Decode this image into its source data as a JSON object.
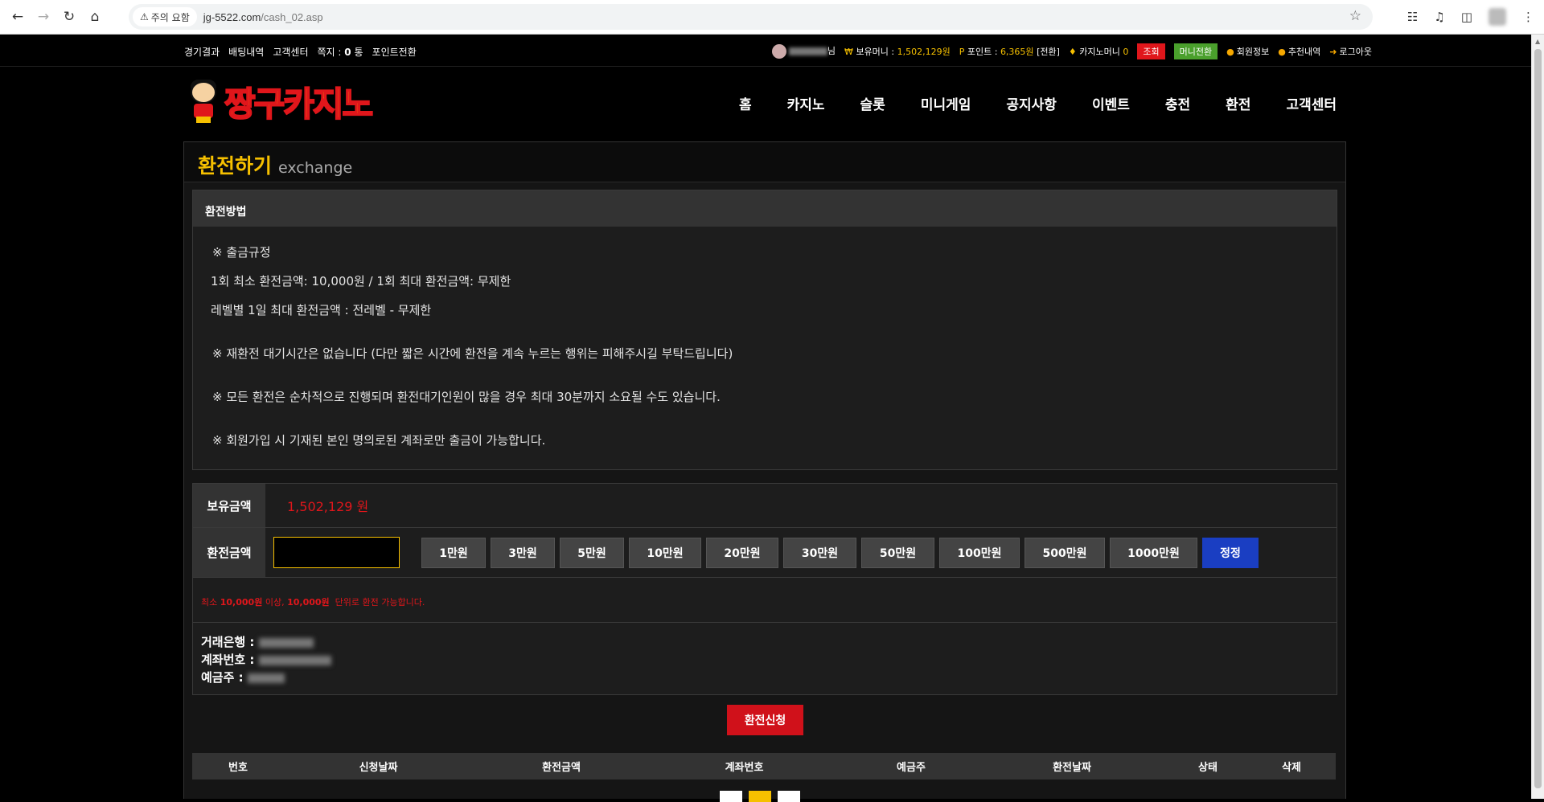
{
  "browser": {
    "security_chip": "주의 요함",
    "url_host": "jg-5522.com",
    "url_path": "/cash_02.asp"
  },
  "topbar": {
    "links": [
      "경기결과",
      "배팅내역",
      "고객센터"
    ],
    "memo_label": "쪽지 :",
    "memo_count": "0",
    "memo_unit": "통",
    "point_convert": "포인트전환",
    "user_suffix": "님",
    "money_label": "보유머니 :",
    "money_value": "1,502,129원",
    "point_label": "포인트 :",
    "point_value": "6,365원",
    "point_action": "[전환]",
    "casino_money_label": "카지노머니",
    "casino_money_value": "0",
    "check_button": "조회",
    "money_convert_button": "머니전환",
    "member_info": "회원정보",
    "referral": "추천내역",
    "logout": "로그아웃"
  },
  "header": {
    "logo_text": "짱구카지노",
    "nav": [
      "홈",
      "카지노",
      "슬롯",
      "미니게임",
      "공지사항",
      "이벤트",
      "충전",
      "환전",
      "고객센터"
    ]
  },
  "page": {
    "title_ko": "환전하기",
    "title_en": "exchange"
  },
  "method": {
    "heading": "환전방법",
    "lines": [
      "※ 출금규정",
      "1회 최소 환전금액: 10,000원 / 1회 최대 환전금액: 무제한",
      "레벨별 1일 최대 환전금액 : 전레벨 - 무제한",
      "※ 재환전 대기시간은 없습니다 (다만 짧은 시간에 환전을 계속 누르는 행위는 피해주시길 부탁드립니다)",
      "※ 모든 환전은 순차적으로 진행되며 환전대기인원이 많을 경우 최대 30분까지 소요될 수도 있습니다.",
      "※ 회원가입 시 기재된 본인 명의로된 계좌로만 출금이 가능합니다."
    ]
  },
  "form": {
    "balance_label": "보유금액",
    "balance_value": "1,502,129 원",
    "exchange_label": "환전금액",
    "amount_value": "",
    "amount_buttons": [
      "1만원",
      "3만원",
      "5만원",
      "10만원",
      "20만원",
      "30만원",
      "50만원",
      "100만원",
      "500만원",
      "1000만원"
    ],
    "reset_button": "정정",
    "notice_prefix": "최소",
    "notice_min": "10,000원",
    "notice_mid": "이상,",
    "notice_unit": "10,000원",
    "notice_suffix": "단위로 환전 가능합니다.",
    "bank_label": "거래은행 :",
    "account_label": "계좌번호 :",
    "holder_label": "예금주 :"
  },
  "submit_button": "환전신청",
  "table": {
    "headers": [
      "번호",
      "신청날짜",
      "환전금액",
      "계좌번호",
      "예금주",
      "환전날짜",
      "상태",
      "삭제"
    ]
  },
  "colors": {
    "accent_yellow": "#f6c000",
    "accent_red": "#e0161b",
    "blue_button": "#1a3ec2",
    "green_badge": "#4aa02c"
  }
}
